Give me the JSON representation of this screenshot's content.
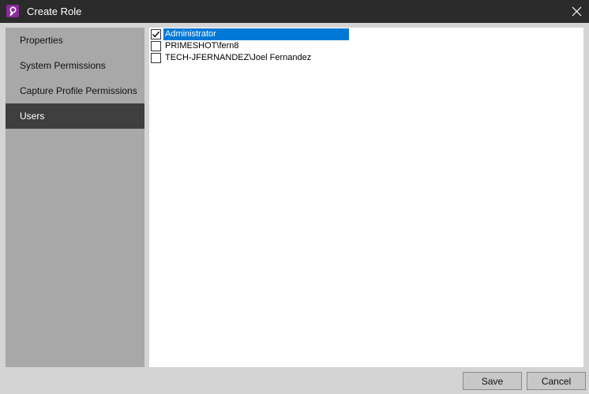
{
  "window": {
    "title": "Create Role",
    "accent_color": "#8a2a9e"
  },
  "sidebar": {
    "items": [
      {
        "label": "Properties",
        "active": false
      },
      {
        "label": "System Permissions",
        "active": false
      },
      {
        "label": "Capture Profile Permissions",
        "active": false
      },
      {
        "label": "Users",
        "active": true
      }
    ]
  },
  "users": [
    {
      "label": "Administrator",
      "checked": true,
      "selected": true
    },
    {
      "label": "PRIMESHOT\\fern8",
      "checked": false,
      "selected": false
    },
    {
      "label": "TECH-JFERNANDEZ\\Joel Fernandez",
      "checked": false,
      "selected": false
    }
  ],
  "footer": {
    "save_label": "Save",
    "cancel_label": "Cancel"
  },
  "colors": {
    "selection": "#0078d7",
    "sidebar_bg": "#a8a8a8",
    "sidebar_active_bg": "#3f3f3f",
    "titlebar_bg": "#2b2b2b"
  }
}
